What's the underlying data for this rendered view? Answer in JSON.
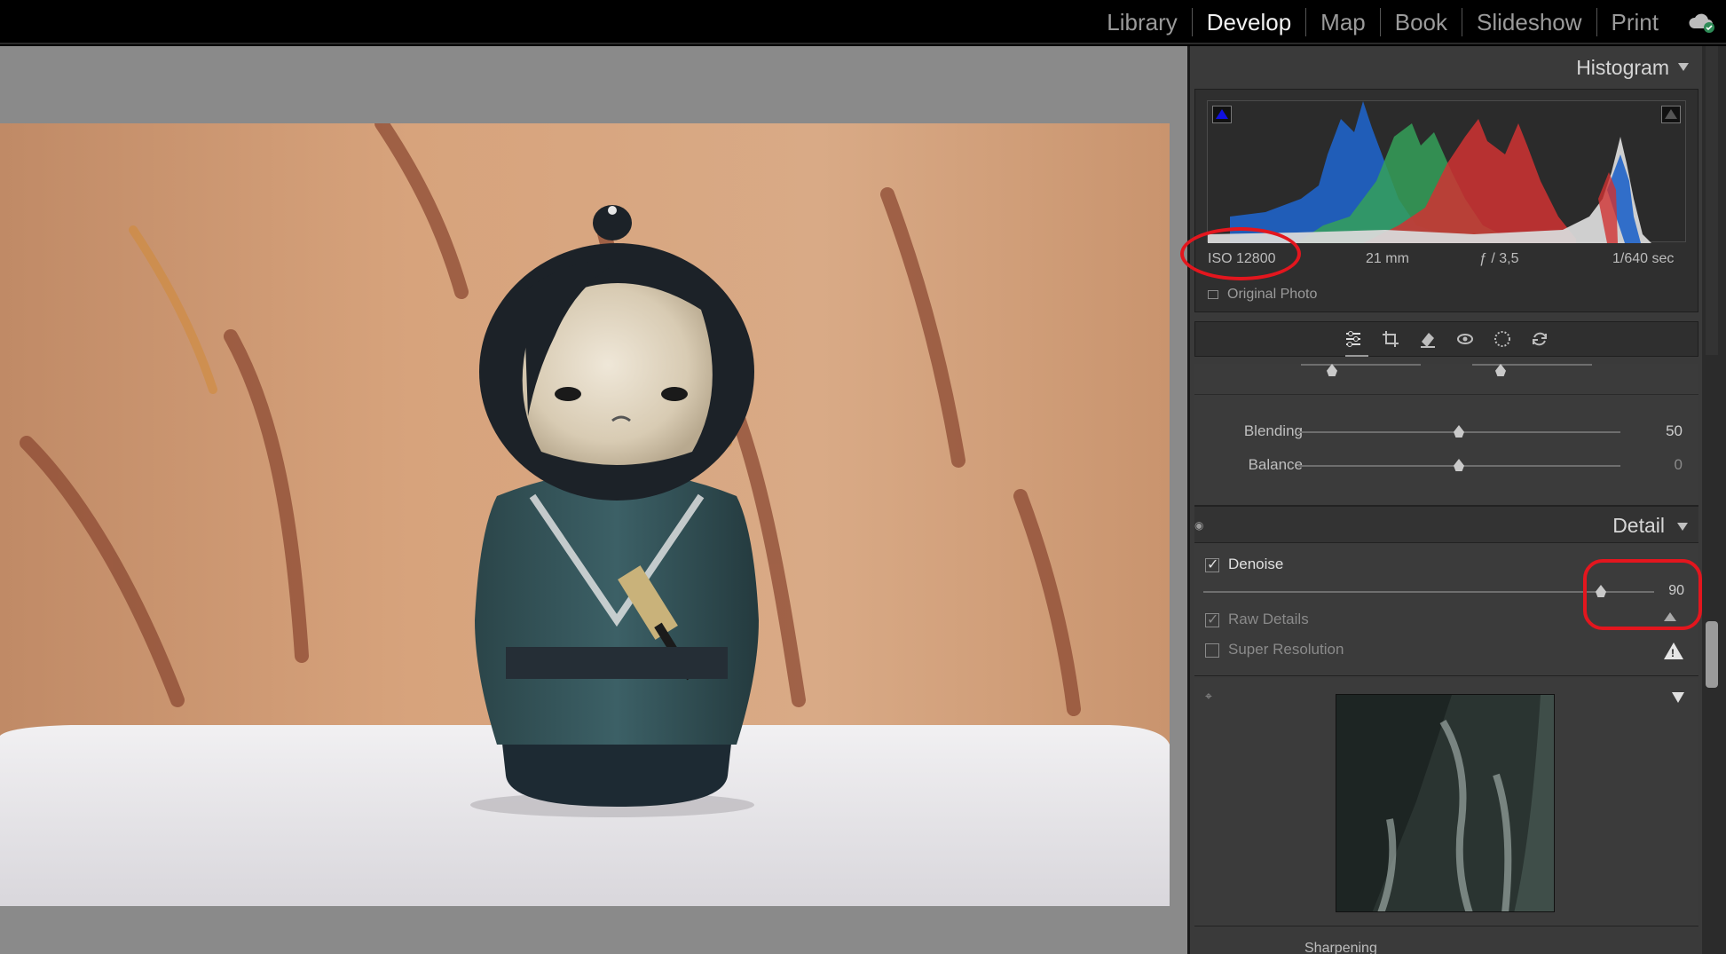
{
  "modules": [
    "Library",
    "Develop",
    "Map",
    "Book",
    "Slideshow",
    "Print"
  ],
  "active_module": "Develop",
  "histogram": {
    "title": "Histogram",
    "exif": {
      "iso": "ISO 12800",
      "focal": "21 mm",
      "aperture": "ƒ / 3,5",
      "shutter": "1/640 sec"
    },
    "original_photo_label": "Original Photo",
    "original_photo_checked": false
  },
  "tools": [
    "edit-sliders-icon",
    "crop-icon",
    "healing-icon",
    "red-eye-icon",
    "masking-icon",
    "reset-icon"
  ],
  "upper_sliders": [
    {
      "label": "Blending",
      "value": "50",
      "position": 0.5
    },
    {
      "label": "Balance",
      "value": "0",
      "position": 0.5
    }
  ],
  "detail": {
    "title": "Detail",
    "denoise": {
      "label": "Denoise",
      "checked": true,
      "value": "90",
      "position": 0.9
    },
    "raw_details": {
      "label": "Raw Details",
      "checked": true
    },
    "super_resolution": {
      "label": "Super Resolution",
      "checked": false
    },
    "sharpening_label": "Sharpening"
  },
  "annotation_color": "#e3161e",
  "accent": {
    "active_text": "#f2f2f2",
    "panel_bg": "#3b3b3b"
  }
}
